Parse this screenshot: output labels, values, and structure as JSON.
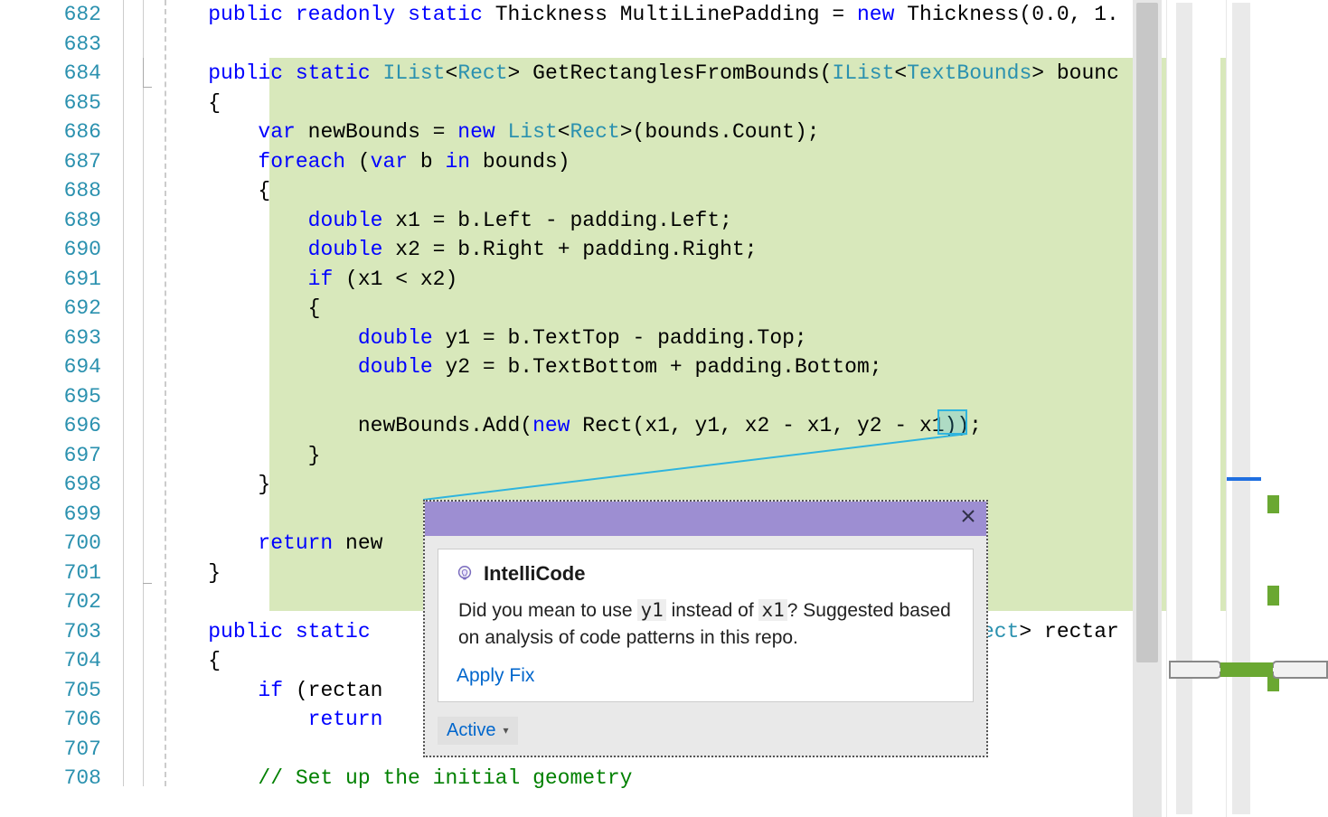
{
  "lines": {
    "start": 682,
    "end": 708
  },
  "code": {
    "l682a": "public",
    "l682b": " readonly",
    "l682c": " static",
    "l682d": " Thickness MultiLinePadding = ",
    "l682e": "new",
    "l682f": " Thickness(0.0, 1.",
    "l684a": "public",
    "l684b": " static",
    "l684c": " IList",
    "l684d": "<",
    "l684e": "Rect",
    "l684f": "> GetRectanglesFromBounds(",
    "l684g": "IList",
    "l684h": "<",
    "l684i": "TextBounds",
    "l684j": "> bounc",
    "l685": "{",
    "l686a": "var",
    "l686b": " newBounds = ",
    "l686c": "new",
    "l686d": " List",
    "l686e": "<",
    "l686f": "Rect",
    "l686g": ">(bounds.Count);",
    "l687a": "foreach",
    "l687b": " (",
    "l687c": "var",
    "l687d": " b ",
    "l687e": "in",
    "l687f": " bounds)",
    "l688": "{",
    "l689a": "double",
    "l689b": " x1 = b.Left - padding.Left;",
    "l690a": "double",
    "l690b": " x2 = b.Right + padding.Right;",
    "l691a": "if",
    "l691b": " (x1 < x2)",
    "l692": "{",
    "l693a": "double",
    "l693b": " y1 = b.TextTop - padding.Top;",
    "l694a": "double",
    "l694b": " y2 = b.TextBottom + padding.Bottom;",
    "l696a": "newBounds.Add(",
    "l696b": "new",
    "l696c": " Rect",
    "l696d": "(x1, y1, x2 - x1, y2 - ",
    "l696e": "x1",
    "l696f": "));",
    "l697": "}",
    "l698": "}",
    "l700a": "return",
    "l700b": " new",
    "l701": "}",
    "l703a": "public",
    "l703b": " static",
    "l703c": " ",
    "l703d": "Rect",
    "l703e": "> rectar",
    "l704": "{",
    "l705a": "if",
    "l705b": " (rectan",
    "l706a": "return",
    "l708a": "// Set up the initial geometry"
  },
  "popup": {
    "title": "IntelliCode",
    "msg_pre": "Did you mean to use ",
    "msg_tok1": "y1",
    "msg_mid": " instead of ",
    "msg_tok2": "x1",
    "msg_post": "? Suggested based on analysis of code patterns in this repo.",
    "apply": "Apply Fix",
    "active": "Active"
  }
}
